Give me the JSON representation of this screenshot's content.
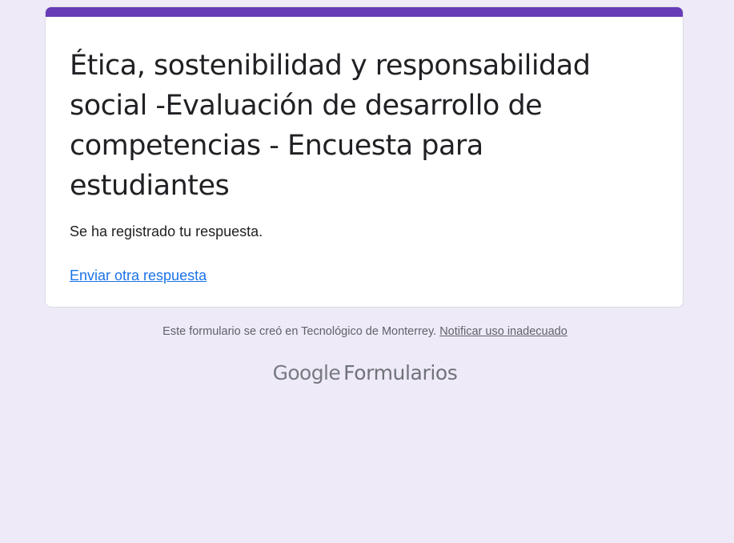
{
  "form": {
    "title": "Ética, sostenibilidad y responsabilidad social -Evaluación de desarrollo de competencias - Encuesta para estudiantes",
    "confirmation_message": "Se ha registrado tu respuesta.",
    "submit_another_link": "Enviar otra respuesta"
  },
  "footer": {
    "created_in_text": "Este formulario se creó en Tecnológico de Monterrey.",
    "report_abuse_link": "Notificar uso inadecuado",
    "brand_google": "Google",
    "brand_product": "Formularios"
  },
  "colors": {
    "page_background": "#efeaf8",
    "accent": "#673ab7",
    "link": "#1a73e8",
    "text_primary": "#202124",
    "text_secondary": "#5f6368"
  }
}
